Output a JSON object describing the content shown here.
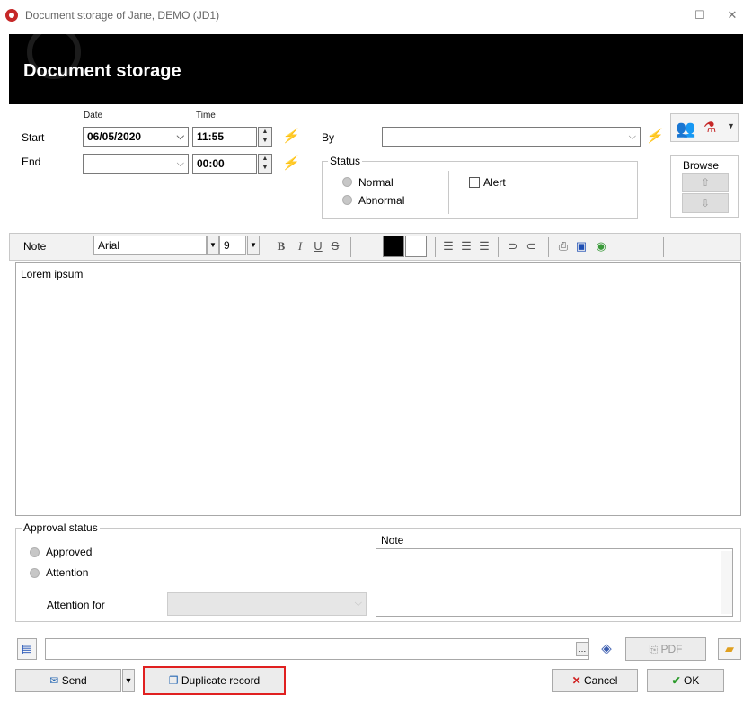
{
  "window": {
    "title": "Document storage of Jane, DEMO (JD1)"
  },
  "banner": {
    "title": "Document storage"
  },
  "form": {
    "date_header": "Date",
    "time_header": "Time",
    "start_label": "Start",
    "end_label": "End",
    "start_date": "06/05/2020",
    "start_time": "11:55",
    "end_date": "",
    "end_time": "00:00",
    "by_label": "By",
    "by_value": ""
  },
  "status": {
    "legend": "Status",
    "options": [
      "Normal",
      "Abnormal"
    ],
    "alert_label": "Alert"
  },
  "browse": {
    "label": "Browse"
  },
  "toolbar": {
    "note_label": "Note",
    "font": "Arial",
    "size": "9",
    "bold": "B",
    "italic": "I",
    "underline": "U",
    "strike": "S"
  },
  "editor": {
    "text": "Lorem ipsum"
  },
  "approval": {
    "legend": "Approval status",
    "approved": "Approved",
    "attention": "Attention",
    "attention_for": "Attention for",
    "note_label": "Note"
  },
  "bottom": {
    "pdf": "PDF",
    "send": "Send",
    "duplicate": "Duplicate record",
    "cancel": "Cancel",
    "ok": "OK"
  }
}
